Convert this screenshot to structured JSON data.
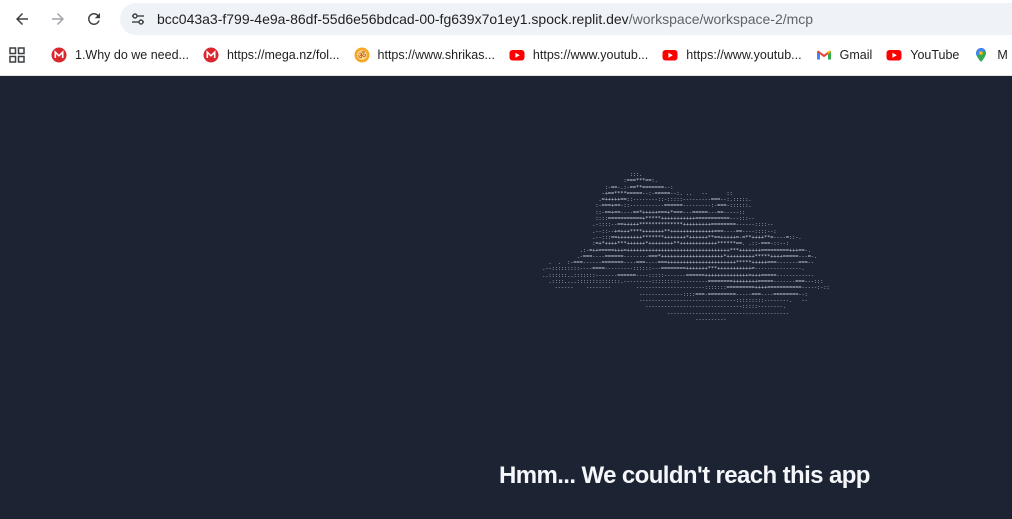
{
  "browser": {
    "url_host": "bcc043a3-f799-4e9a-86df-55d6e56bdcad-00-fg639x7o1ey1.spock.replit.dev",
    "url_path": "/workspace/workspace-2/mcp",
    "nav": {
      "back_icon": "arrow-left-icon",
      "forward_icon": "arrow-right-icon",
      "reload_icon": "reload-icon",
      "site_info_icon": "tune-icon"
    },
    "bookmarks": [
      {
        "label": "1.Why do we need...",
        "icon": "mega-icon"
      },
      {
        "label": "https://mega.nz/fol...",
        "icon": "mega-icon"
      },
      {
        "label": "https://www.shrikas...",
        "icon": "om-icon"
      },
      {
        "label": "https://www.youtub...",
        "icon": "youtube-icon"
      },
      {
        "label": "https://www.youtub...",
        "icon": "youtube-icon"
      },
      {
        "label": "Gmail",
        "icon": "gmail-icon"
      },
      {
        "label": "YouTube",
        "icon": "youtube-icon"
      },
      {
        "label": "M",
        "icon": "maps-icon"
      }
    ]
  },
  "page": {
    "ascii_art": "                              :::.\n                            :===***==:.\n                      :-==-.:-==**=======--:\n                     -+==****=====--:-=====--:. ..   --      ::\n                    .=+++++==::--------::-:::::---------===--:.:::::.\n                   :-===+==-::-----------======---------:-===-::::::.\n                   ::-==+==----==*+++++===+*===---=====---==-----::\n                   ::::===========+*****+++++++++++===========---:::--\n                  .-::::--==+++++**************+++++++++========------::::--\n                  .--::--+=+++****+++++++**++++++++++++++===----==----::::--:\n                  .--:::==++++++++*******+++++++*++++++**==+++++=-=**++++**=----=::-.\n                  :=+*++++***++++++*++++++++**++++++++++++******==. .::-===-::--:\n              .:-=++=====+++=+++++++++++++++++++++++++++++++++***+++++++=========+++==-.\n             .-===----======--------===*++++++++++++++++++++*+++++++++*****++++=====---=-.\n    .  .  :-===------=======----===----===++++++++++++++++++++++*****+++++===-------===--\n  .--:::::::::----====---------::::::---========+++++++***+++++++++++=---------------.\n  ..::::::..:::::::-------======----:::::-------======++++++++++++++=+++=====------------\n    .::::....::::::::::::::.---------:::::::::---------========++++++++=====-------===---:::\n      ------    --------        ----------------------:::::::=========++++===========-----:-::\n                                 --------------::::===-=========-----===----========--:\n                                 -------------------------------:::::::::--------.   --\n                                   -------------------------------:::::--------.\n                                          ---------------------------------------\n                                                   ----------",
    "error_heading": "Hmm... We couldn't reach this app"
  }
}
